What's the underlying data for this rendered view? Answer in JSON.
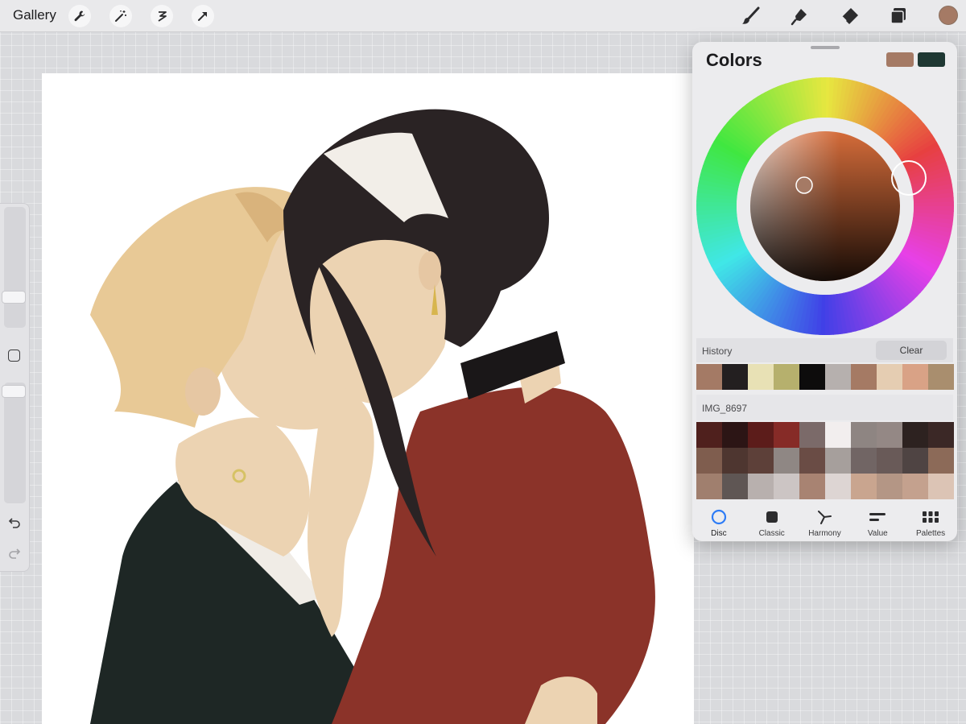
{
  "topbar": {
    "gallery_label": "Gallery",
    "left_tools": [
      "wrench-icon",
      "magic-wand-icon",
      "selection-icon",
      "transform-arrow-icon"
    ],
    "right_tools": [
      "brush-icon",
      "smudge-icon",
      "eraser-icon",
      "layers-icon"
    ],
    "active_color": "#a57a65"
  },
  "canvas": {
    "subject": "Illustration of two characters kissing",
    "colors": {
      "blond_hair": "#e8c996",
      "dark_hair": "#2a2324",
      "skin": "#ecd3b2",
      "red_dress": "#8b3329",
      "dark_suit": "#1e2725",
      "choker": "#1a1718"
    }
  },
  "sidebar": {
    "tools": [
      "brush-size-slider",
      "modify-button",
      "opacity-slider",
      "undo-icon",
      "redo-icon"
    ]
  },
  "colors_panel": {
    "title": "Colors",
    "primary_color": "#a57a65",
    "secondary_color": "#1f3833",
    "history_label": "History",
    "clear_label": "Clear",
    "history": [
      "#a47a65",
      "#231f20",
      "#e8e1b5",
      "#b6b06d",
      "#0d0c0c",
      "#b6b0ae",
      "#a57a64",
      "#e5cdb2",
      "#d9a286",
      "#a98e6e"
    ],
    "palette_label": "IMG_8697",
    "palette": [
      "#4f201d",
      "#2c1515",
      "#5c1c1a",
      "#862b27",
      "#7b6a69",
      "#f2eeee",
      "#8e8582",
      "#948885",
      "#2d2220",
      "#3b2826",
      "#7f5d4e",
      "#4e3630",
      "#5d4039",
      "#8f8784",
      "#6a4c45",
      "#a69f9c",
      "#716564",
      "#695a58",
      "#4f4443",
      "#8c6a58",
      "#a07f6e",
      "#5f5654",
      "#b8b0ae",
      "#ccc5c4",
      "#a88372",
      "#ddd5d3",
      "#c9a58f",
      "#b49685",
      "#c4a18e",
      "#dcc4b5"
    ],
    "tabs": [
      {
        "label": "Disc",
        "icon": "disc-icon"
      },
      {
        "label": "Classic",
        "icon": "classic-square-icon"
      },
      {
        "label": "Harmony",
        "icon": "harmony-icon"
      },
      {
        "label": "Value",
        "icon": "value-sliders-icon"
      },
      {
        "label": "Palettes",
        "icon": "palettes-grid-icon"
      }
    ],
    "active_tab": "Disc"
  }
}
